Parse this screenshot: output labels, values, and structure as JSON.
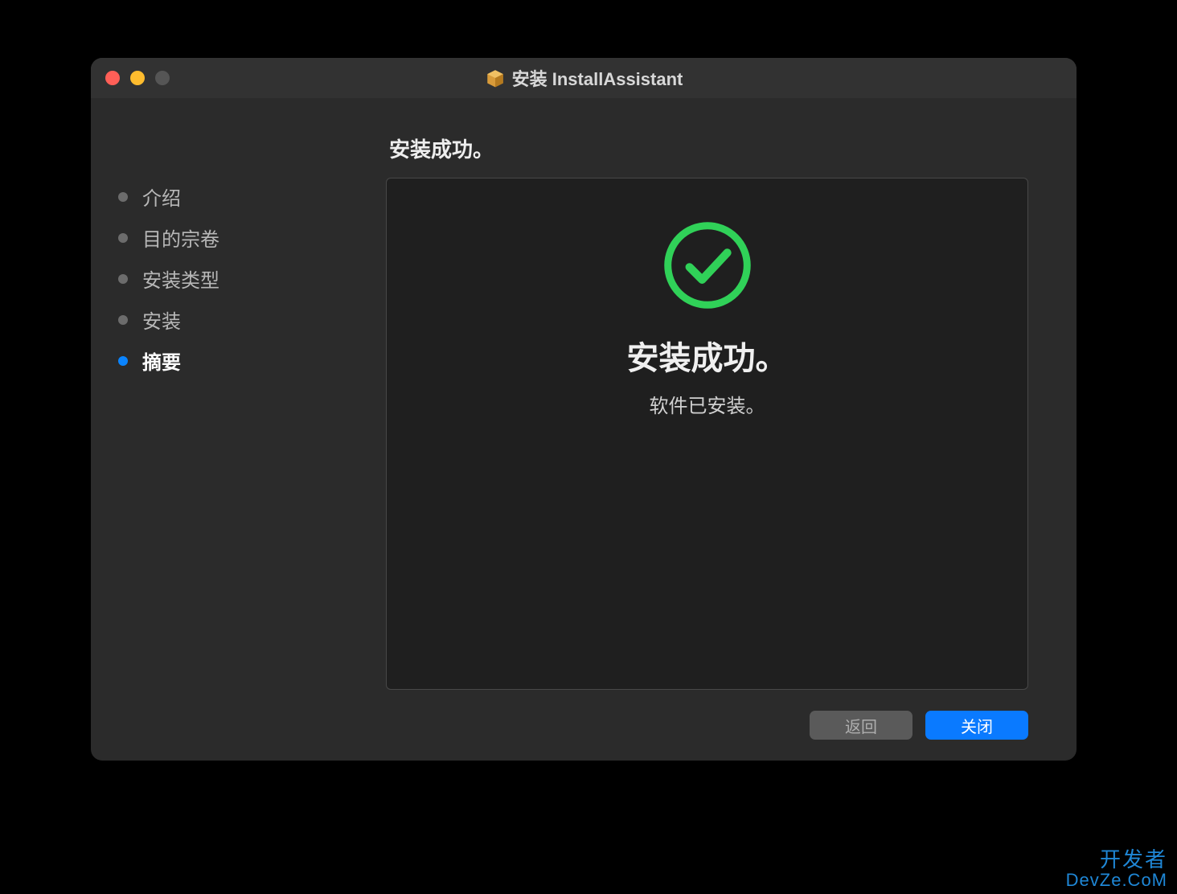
{
  "window": {
    "title": "安装 InstallAssistant"
  },
  "sidebar": {
    "steps": [
      {
        "label": "介绍",
        "active": false
      },
      {
        "label": "目的宗卷",
        "active": false
      },
      {
        "label": "安装类型",
        "active": false
      },
      {
        "label": "安装",
        "active": false
      },
      {
        "label": "摘要",
        "active": true
      }
    ]
  },
  "main": {
    "heading": "安装成功。",
    "success_title": "安装成功。",
    "success_subtitle": "软件已安装。"
  },
  "footer": {
    "back_label": "返回",
    "close_label": "关闭"
  },
  "watermark": {
    "line1": "开发者",
    "line2": "DevZe.CoM"
  },
  "colors": {
    "accent": "#0a84ff",
    "success": "#30d158"
  }
}
